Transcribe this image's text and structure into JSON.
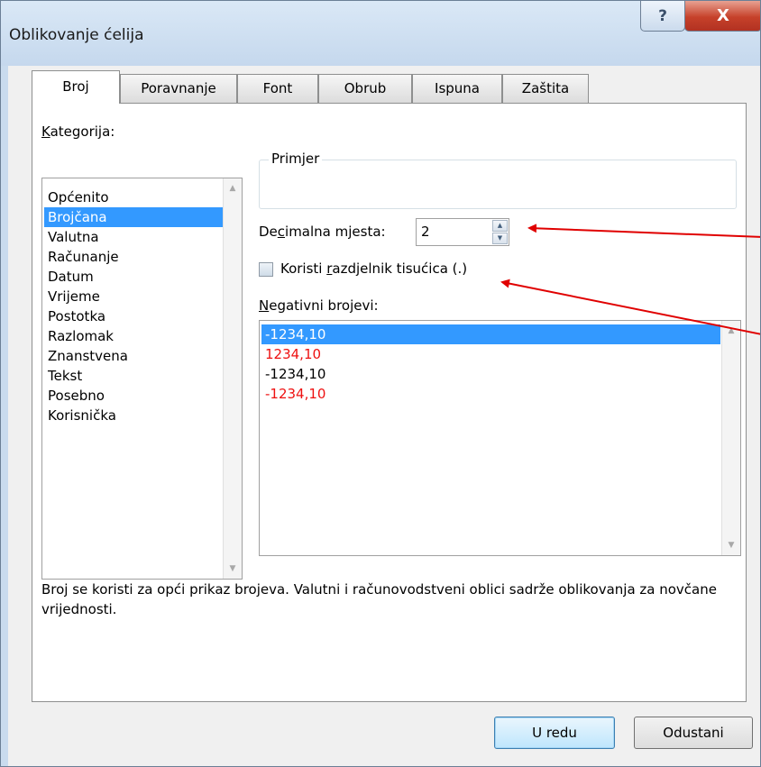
{
  "window": {
    "title": "Oblikovanje ćelija",
    "help_glyph": "?",
    "close_glyph": "X"
  },
  "tabs": [
    {
      "label": "Broj",
      "active": true
    },
    {
      "label": "Poravnanje"
    },
    {
      "label": "Font"
    },
    {
      "label": "Obrub"
    },
    {
      "label": "Ispuna"
    },
    {
      "label": "Zaštita"
    }
  ],
  "category": {
    "label_hotkey": "K",
    "label_rest": "ategorija:",
    "items": [
      "Općenito",
      "Brojčana",
      "Valutna",
      "Računanje",
      "Datum",
      "Vrijeme",
      "Postotka",
      "Razlomak",
      "Znanstvena",
      "Tekst",
      "Posebno",
      "Korisnička"
    ],
    "selected": "Brojčana"
  },
  "sample": {
    "label": "Primjer",
    "value": ""
  },
  "decimal": {
    "label_pre": "De",
    "label_hotkey": "c",
    "label_post": "imalna mjesta:",
    "value": "2"
  },
  "separator": {
    "label_pre": "Koristi ",
    "label_hotkey": "r",
    "label_post": "azdjelnik tisućica (.)",
    "checked": false
  },
  "negative": {
    "label_hotkey": "N",
    "label_rest": "egativni brojevi:",
    "items": [
      {
        "text": "-1234,10",
        "color": "black"
      },
      {
        "text": "1234,10",
        "color": "red"
      },
      {
        "text": "-1234,10",
        "color": "black"
      },
      {
        "text": "-1234,10",
        "color": "red"
      }
    ],
    "selected_index": 0
  },
  "description": "Broj se koristi za opći prikaz brojeva. Valutni i računovodstveni oblici sadrže oblikovanja za novčane vrijednosti.",
  "buttons": {
    "ok": "U redu",
    "cancel": "Odustani"
  },
  "colors": {
    "selection": "#3399ff",
    "negative_red": "#ee1111",
    "annotation_arrow": "#e00000",
    "title_bar": "#c9dbee",
    "close_button": "#c6412a"
  },
  "icons": {
    "spin_up": "spin-up-icon",
    "spin_down": "spin-down-icon",
    "scroll_up": "scroll-up-icon",
    "scroll_down": "scroll-down-icon"
  }
}
